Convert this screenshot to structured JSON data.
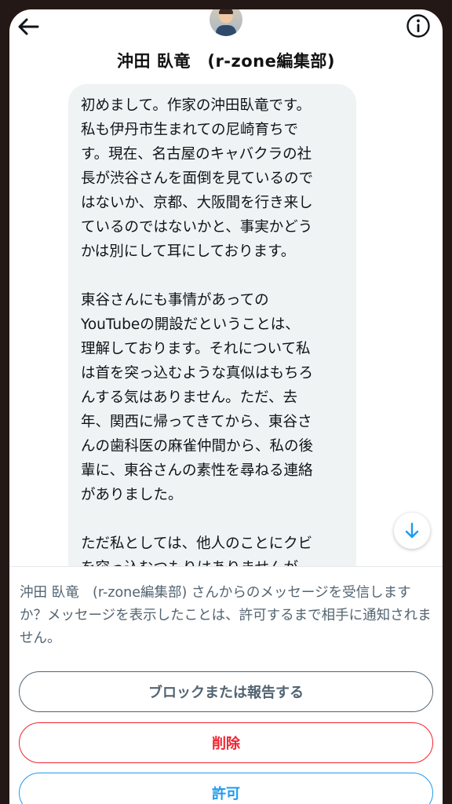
{
  "header": {
    "title": "沖田 臥竜　(r-zone編集部)",
    "back_icon": "arrow-left-icon",
    "info_icon": "info-circle-icon"
  },
  "message": {
    "paragraphs": [
      "初めまして。作家の沖田臥竜です。\n私も伊丹市生まれての尼崎育ちで\nす。現在、名古屋のキャバクラの社\n長が渋谷さんを面倒を見ているので\nはないか、京都、大阪間を行き来し\nているのではないかと、事実かどう\nかは別にして耳にしております。",
      "東谷さんにも事情があっての\nYouTubeの開設だということは、\n理解しております。それについて私\nは首を突っ込むような真似はもちろ\nんする気はありません。ただ、去\n年、関西に帰ってきてから、東谷さ\nんの歯科医の麻雀仲間から、私の後\n輩に、東谷さんの素性を尋ねる連絡\nがありました。",
      "ただ私としては、他人のことにクビ\nを突っ込むつもりはありませんが、\n東谷さんが名前を上げている芸能人\nの中にも　知人がいて　迷惑して"
    ]
  },
  "scroll_button": {
    "icon": "arrow-down-icon"
  },
  "request_panel": {
    "notice": "沖田 臥竜　(r-zone編集部) さんからのメッセージを受信しますか？メッセージを表示したことは、許可するまで相手に通知されません。",
    "block_label": "ブロックまたは報告する",
    "delete_label": "削除",
    "allow_label": "許可"
  },
  "colors": {
    "frame": "#231815",
    "bubble": "#eff3f4",
    "text": "#0f1419",
    "secondary": "#536471",
    "delete": "#f4212e",
    "allow": "#1d9bf0"
  }
}
